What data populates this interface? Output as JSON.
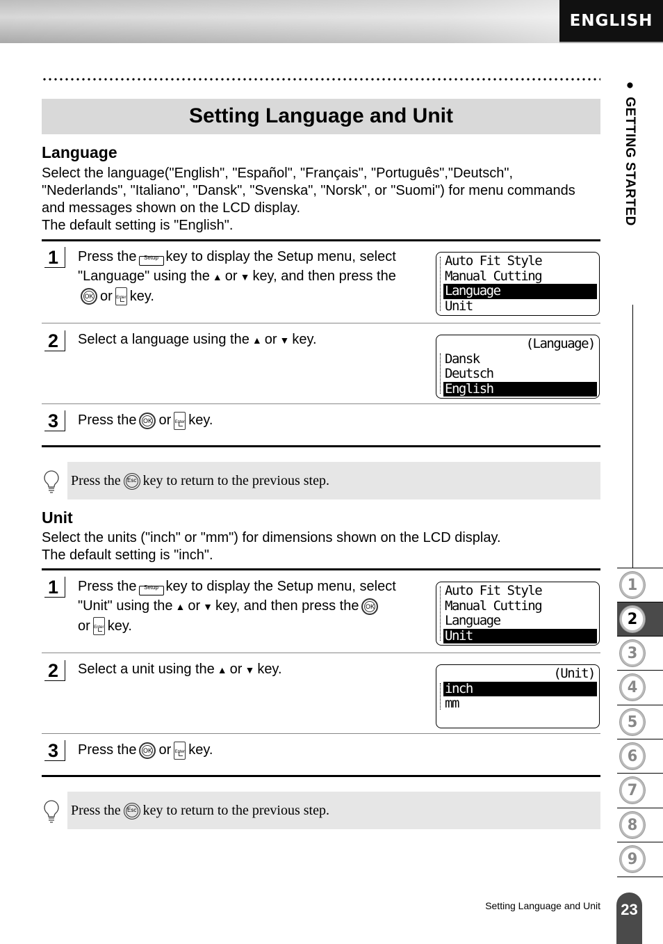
{
  "header": {
    "language_tab": "ENGLISH"
  },
  "title": "Setting Language and Unit",
  "side": {
    "section": "GETTING STARTED",
    "tabs": [
      "1",
      "2",
      "3",
      "4",
      "5",
      "6",
      "7",
      "8",
      "9"
    ],
    "active_tab": "2"
  },
  "language": {
    "heading": "Language",
    "para": [
      "Select the language(\"English\", \"Español\", \"Français\", \"Português\",\"Deutsch\",",
      "\"Nederlands\", \"Italiano\", \"Dansk\", \"Svenska\", \"Norsk\", or \"Suomi\") for menu commands",
      "and messages shown on the LCD display.",
      "The default setting is \"English\"."
    ],
    "steps": [
      {
        "num": "1",
        "parts": [
          "Press the",
          "key to display the Setup menu, select \"Language\" using the",
          "or",
          "key, and then press the",
          "or",
          "key."
        ],
        "lcd": {
          "rows": [
            "Auto Fit Style",
            "Manual Cutting",
            "Language",
            "Unit"
          ],
          "selected": "Language"
        }
      },
      {
        "num": "2",
        "parts": [
          "Select a language using the",
          "or",
          "key."
        ],
        "lcd": {
          "header": "(Language)",
          "rows": [
            "Dansk",
            "Deutsch",
            "English"
          ],
          "selected": "English"
        }
      },
      {
        "num": "3",
        "parts": [
          "Press the",
          "or",
          "key."
        ]
      }
    ],
    "tip": [
      "Press the",
      "key to return to the previous step."
    ]
  },
  "unit": {
    "heading": "Unit",
    "para": [
      "Select the units (\"inch\" or \"mm\") for dimensions shown on the LCD display.",
      "The default setting is \"inch\"."
    ],
    "steps": [
      {
        "num": "1",
        "parts": [
          "Press the",
          "key to display the Setup menu, select \"Unit\" using the",
          "or",
          "key, and then press the",
          "or",
          "key."
        ],
        "lcd": {
          "rows": [
            "Auto Fit Style",
            "Manual Cutting",
            "Language",
            "Unit"
          ],
          "selected": "Unit"
        }
      },
      {
        "num": "2",
        "parts": [
          "Select a unit using the",
          "or",
          "key."
        ],
        "lcd": {
          "header": "(Unit)",
          "rows": [
            "inch",
            "mm"
          ],
          "selected": "inch"
        }
      },
      {
        "num": "3",
        "parts": [
          "Press the",
          "or",
          "key."
        ]
      }
    ],
    "tip": [
      "Press the",
      "key to return to the previous step."
    ]
  },
  "keys": {
    "setup": "Setup",
    "ok": "OK",
    "enter": "Enter",
    "esc": "Esc"
  },
  "footer": {
    "text": "Setting Language and Unit",
    "page": "23"
  }
}
